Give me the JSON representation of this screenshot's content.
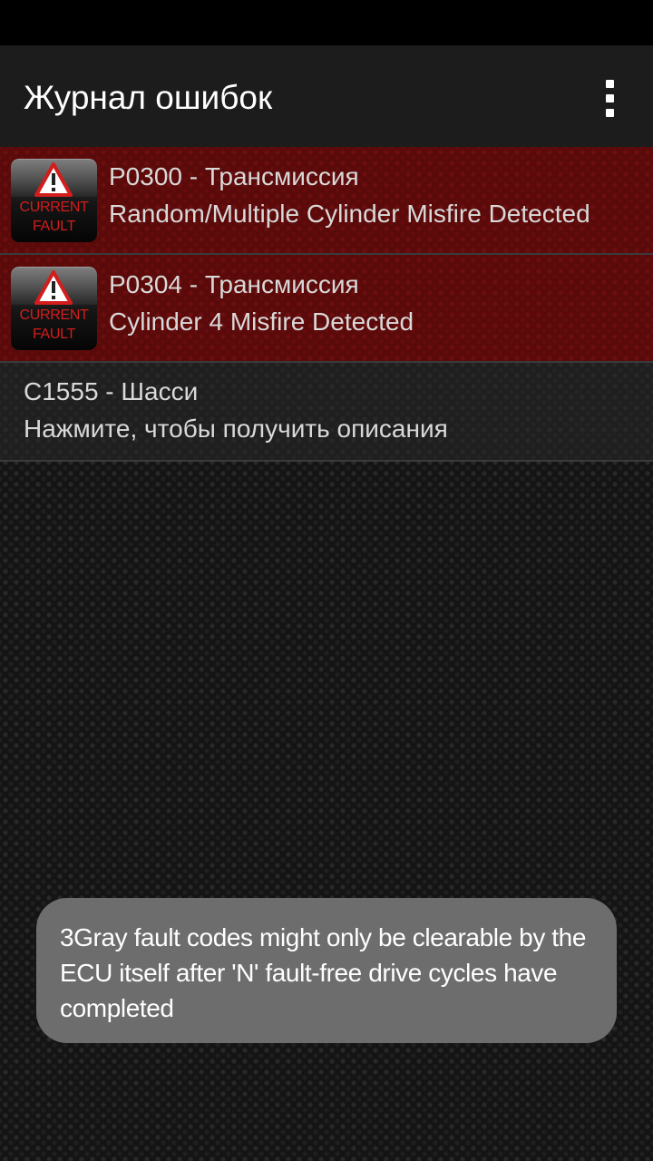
{
  "app_bar": {
    "title": "Журнал ошибок",
    "menu_icon": "overflow-menu-icon"
  },
  "faults": [
    {
      "code": "P0300 - Трансмиссия",
      "description": "Random/Multiple Cylinder Misfire Detected",
      "status": "current",
      "badge": {
        "icon": "warning-triangle-icon",
        "line1": "CURRENT",
        "line2": "FAULT"
      }
    },
    {
      "code": "P0304 - Трансмиссия",
      "description": "Cylinder 4 Misfire Detected",
      "status": "current",
      "badge": {
        "icon": "warning-triangle-icon",
        "line1": "CURRENT",
        "line2": "FAULT"
      }
    },
    {
      "code": "C1555 - Шасси",
      "description": "Нажмите, чтобы получить описания",
      "status": "history"
    }
  ],
  "toast": {
    "text": "3Gray fault codes might only be clearable by the ECU itself after 'N' fault-free drive cycles have completed"
  },
  "colors": {
    "current_fault_row": "#5a0a0a",
    "badge_text": "#d21d1d",
    "toast_background": "#6d6d6d",
    "app_bar": "#1c1c1c"
  }
}
